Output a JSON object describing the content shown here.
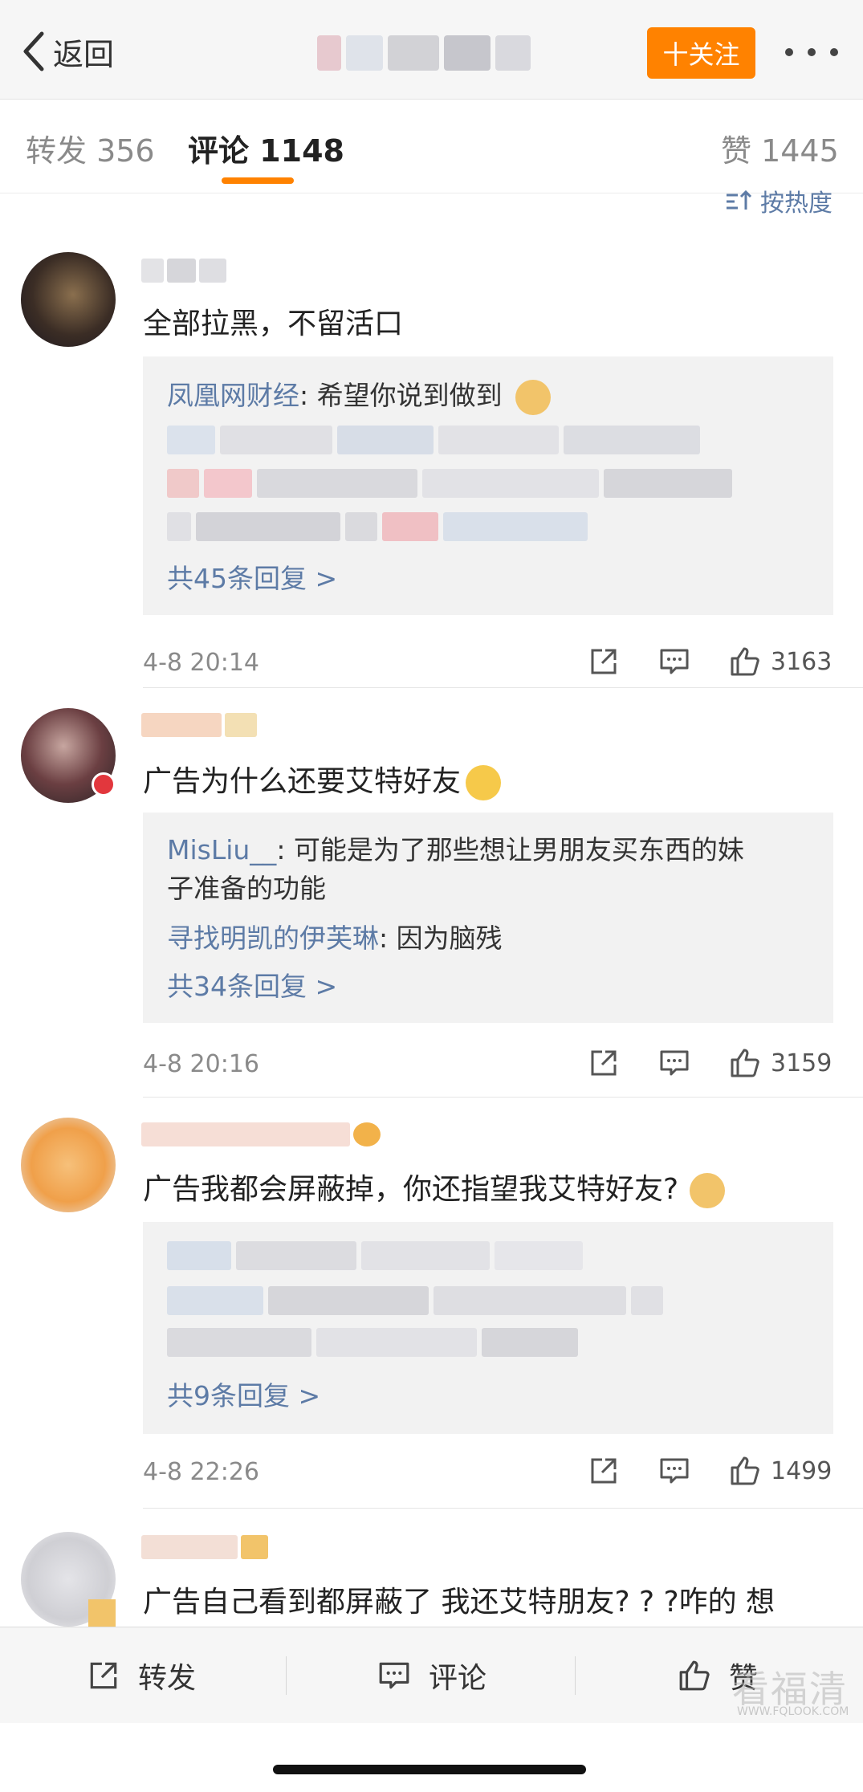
{
  "nav": {
    "back_label": "返回",
    "follow_label": "十关注"
  },
  "tabs": {
    "repost": "转发 356",
    "comments": "评论 1148",
    "likes": "赞 1445"
  },
  "sort_label": "按热度",
  "comments": [
    {
      "text": "全部拉黑，不留活口",
      "replies": [
        {
          "name": "凤凰网财经",
          "text": ": 希望你说到做到"
        }
      ],
      "more_replies": "共45条回复 >",
      "time": "4-8 20:14",
      "likes": "3163"
    },
    {
      "text": "广告为什么还要艾特好友",
      "replies": [
        {
          "name": "MisLiu__",
          "text": ": 可能是为了那些想让男朋友买东西的妹",
          "cont": "子准备的功能"
        },
        {
          "name": "寻找明凯的伊芙琳",
          "text": ": 因为脑残"
        }
      ],
      "more_replies": "共34条回复 >",
      "time": "4-8 20:16",
      "likes": "3159"
    },
    {
      "text": "广告我都会屏蔽掉，你还指望我艾特好友?",
      "replies": [],
      "more_replies": "共9条回复 >",
      "time": "4-8 22:26",
      "likes": "1499"
    },
    {
      "text": "广告自己看到都屏蔽了 我还艾特朋友? ? ?咋的 想"
    }
  ],
  "bottom": {
    "repost": "转发",
    "comment": "评论",
    "like": "赞"
  },
  "watermark": {
    "main": "看福清",
    "sub": "WWW.FQLOOK.COM"
  },
  "colors": {
    "accent": "#ff8200",
    "link": "#5d7ba6"
  }
}
